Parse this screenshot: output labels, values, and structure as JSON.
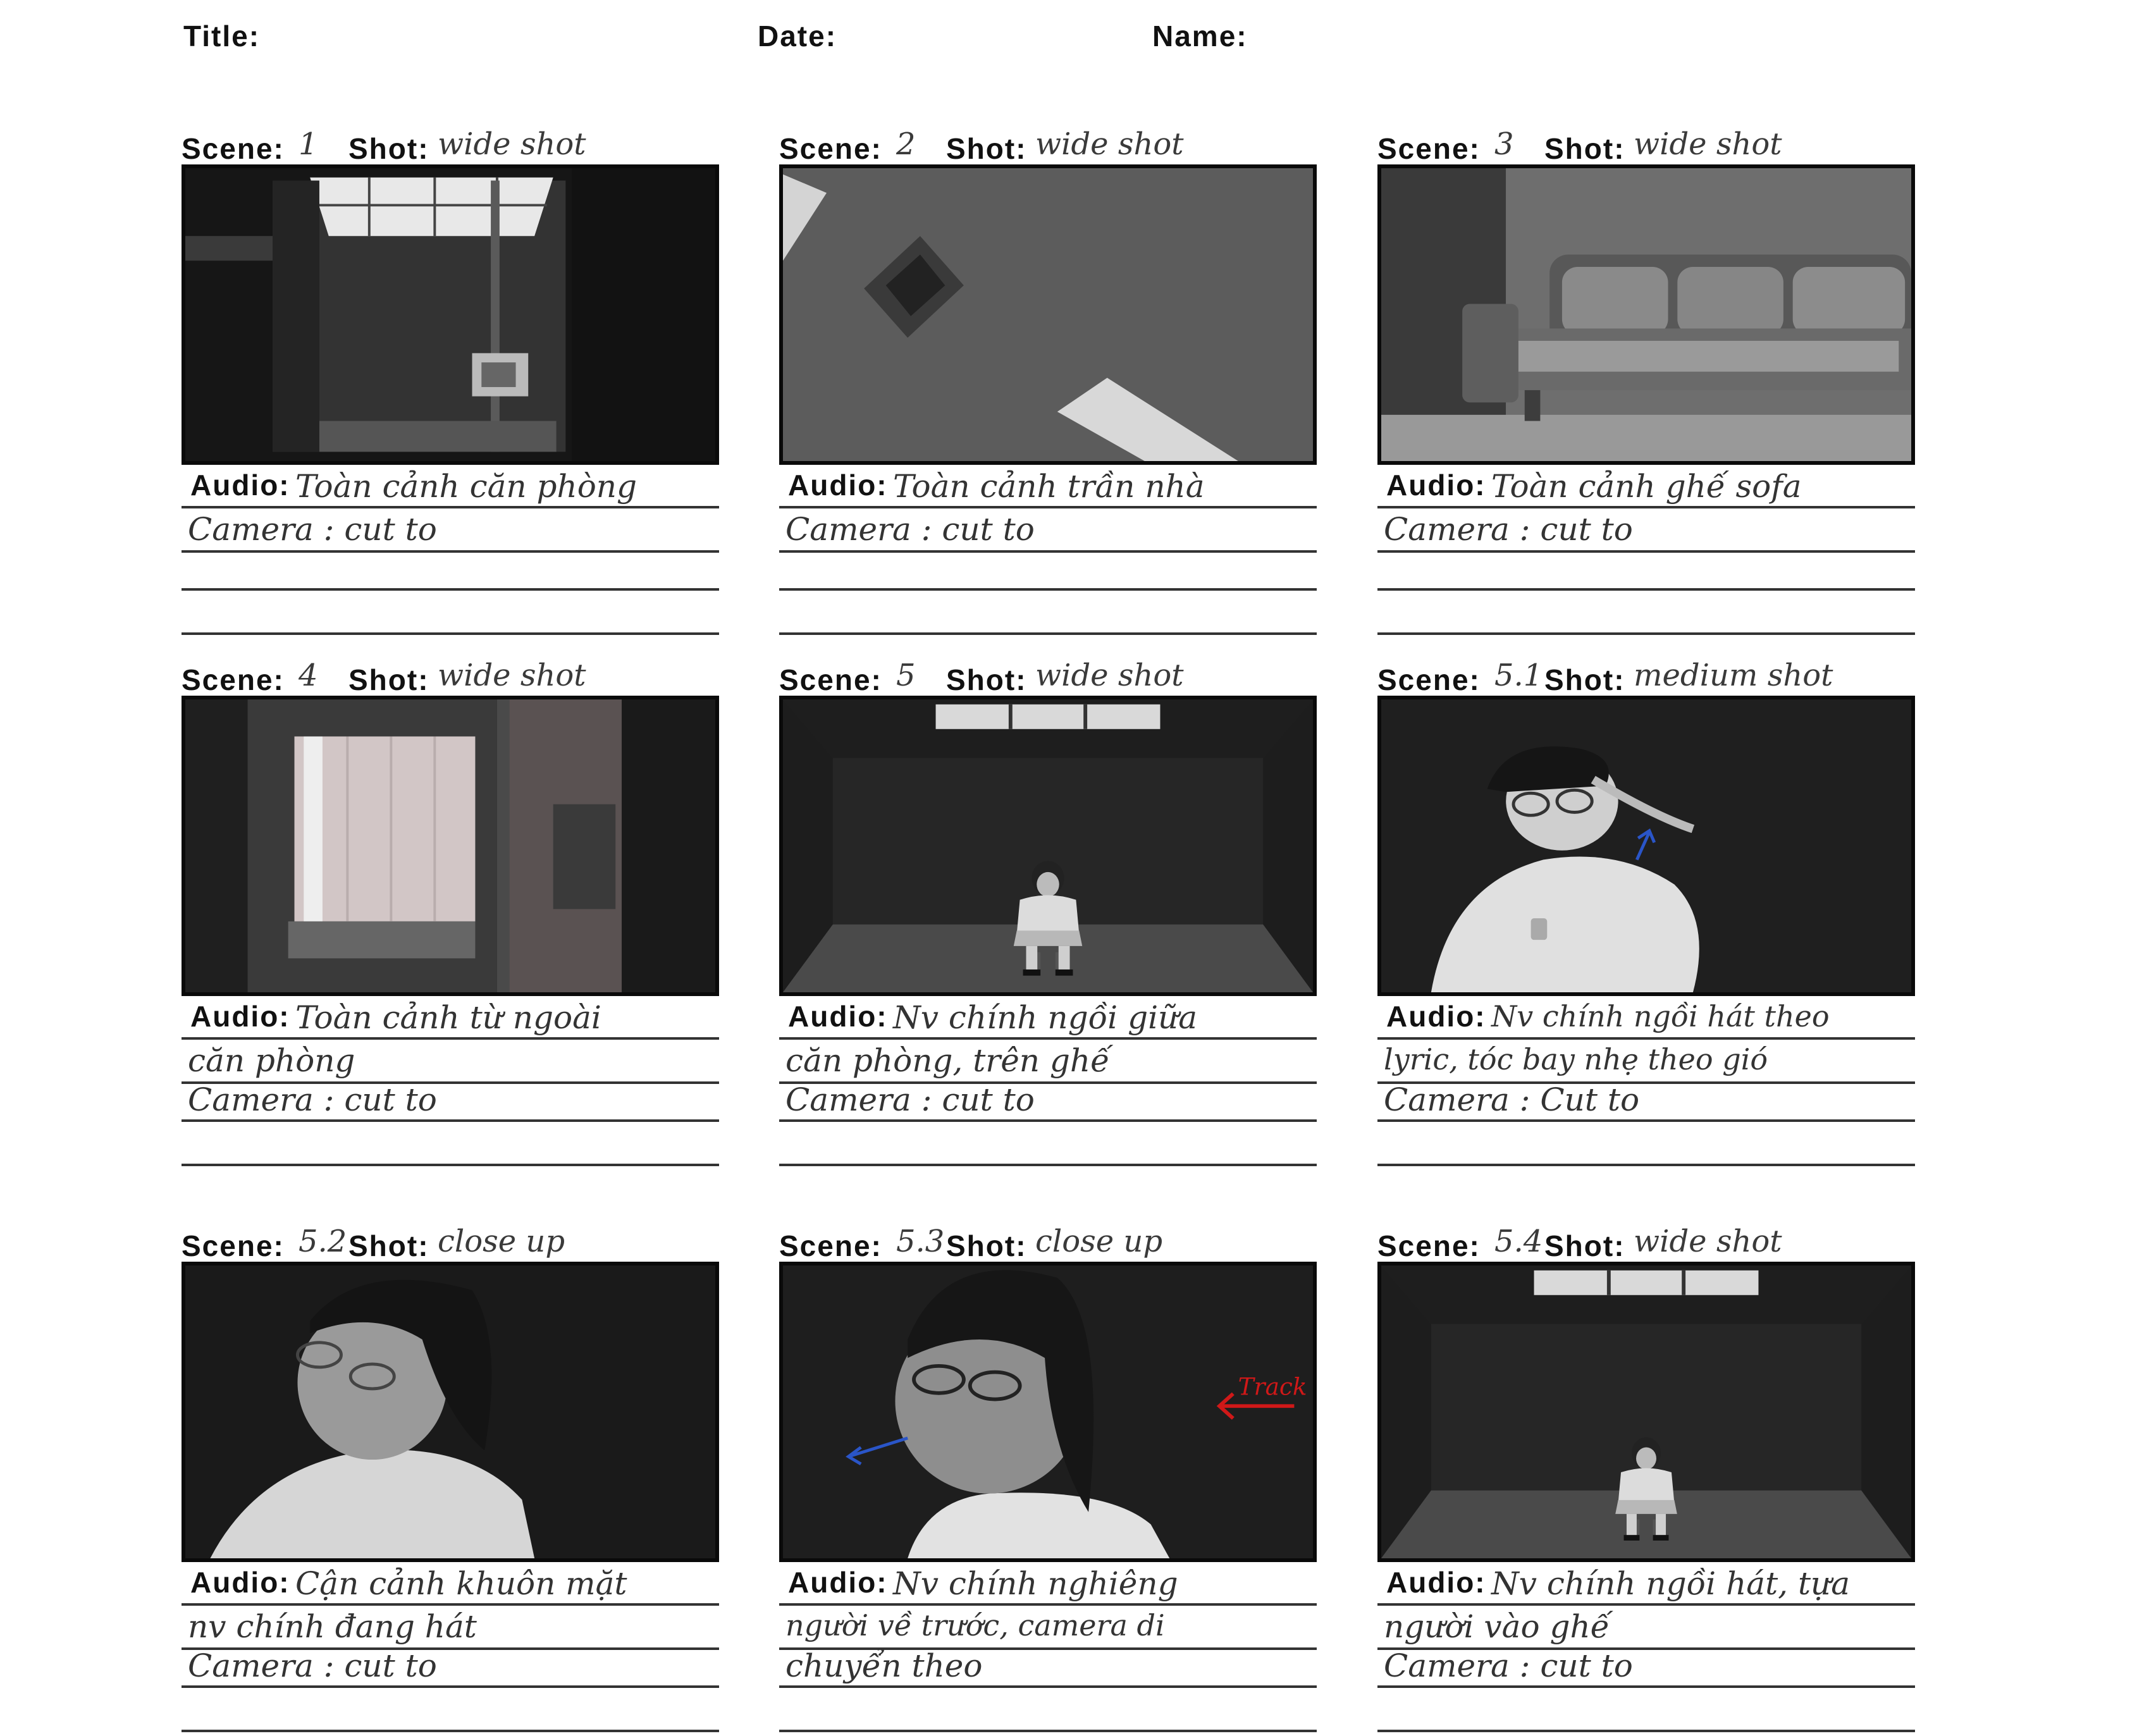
{
  "header": {
    "title_label": "Title:",
    "date_label": "Date:",
    "name_label": "Name:"
  },
  "labels": {
    "scene": "Scene:",
    "shot": "Shot:",
    "audio": "Audio:"
  },
  "panels": [
    {
      "scene": "1",
      "shot": "wide shot",
      "lines": [
        "Toàn cảnh căn phòng",
        "Camera : cut to",
        "",
        ""
      ]
    },
    {
      "scene": "2",
      "shot": "wide shot",
      "lines": [
        "Toàn cảnh trần nhà",
        "Camera : cut to",
        "",
        ""
      ]
    },
    {
      "scene": "3",
      "shot": "wide shot",
      "lines": [
        "Toàn cảnh ghế sofa",
        "Camera : cut to",
        "",
        ""
      ]
    },
    {
      "scene": "4",
      "shot": "wide shot",
      "lines": [
        "Toàn cảnh từ ngoài",
        "căn phòng",
        "Camera : cut to",
        ""
      ]
    },
    {
      "scene": "5",
      "shot": "wide shot",
      "lines": [
        "Nv chính ngồi giữa",
        "căn phòng, trên ghế",
        "Camera : cut to",
        ""
      ]
    },
    {
      "scene": "5.1",
      "shot": "medium shot",
      "lines": [
        "Nv chính ngồi hát theo",
        "lyric, tóc bay nhẹ theo gió",
        "Camera : Cut to",
        ""
      ]
    },
    {
      "scene": "5.2",
      "shot": "close up",
      "lines": [
        "Cận cảnh khuôn mặt",
        "nv chính đang hát",
        "Camera : cut to",
        ""
      ]
    },
    {
      "scene": "5.3",
      "shot": "close up",
      "lines": [
        "Nv chính nghiêng",
        "người về trước, camera di",
        "chuyển theo",
        ""
      ]
    },
    {
      "scene": "5.4",
      "shot": "wide shot",
      "lines": [
        "Nv chính ngồi hát, tựa",
        "người vào ghế",
        "Camera : cut to",
        ""
      ]
    }
  ],
  "annotations": {
    "track_label": "Track"
  },
  "colors": {
    "arrow_blue": "#2a55c8",
    "arrow_red": "#d01818"
  }
}
